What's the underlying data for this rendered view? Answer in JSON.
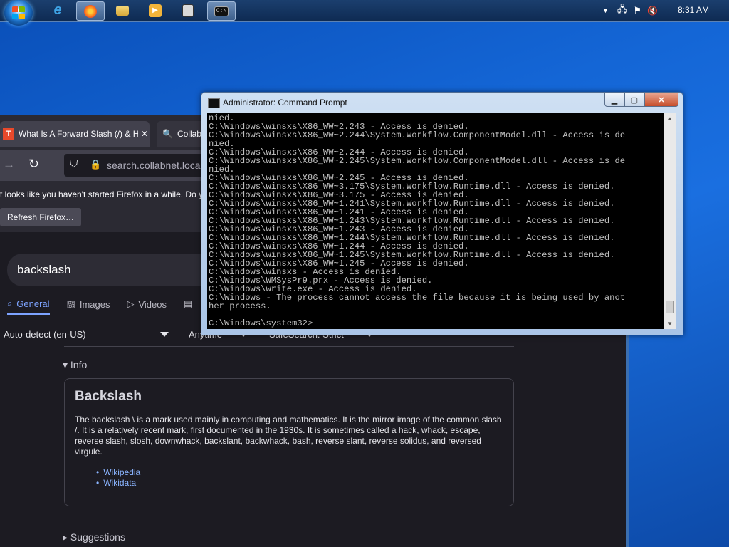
{
  "taskbar": {
    "clock": "8:31 AM",
    "pinned": [
      {
        "name": "internet-explorer-icon",
        "color": "#3ea3e6"
      },
      {
        "name": "firefox-icon",
        "color": "#ff7a1a"
      },
      {
        "name": "file-explorer-icon",
        "color": "#e8c25a"
      },
      {
        "name": "media-player-icon",
        "color": "#f2b43a"
      },
      {
        "name": "calculator-icon",
        "color": "#d9d9d9"
      },
      {
        "name": "cmd-icon",
        "color": "#111111"
      }
    ]
  },
  "browser": {
    "tabs": [
      {
        "label": "What Is A Forward Slash (/) & H",
        "close": "✕"
      },
      {
        "label": "Collab"
      }
    ],
    "url": "search.collabnet.local/",
    "notice_text": "t looks like you haven't started Firefox in a while. Do y",
    "refresh_label": "Refresh Firefox…",
    "search_query": "backslash",
    "search_tabs": [
      "General",
      "Images",
      "Videos"
    ],
    "filters": {
      "language": "Auto-detect (en-US)",
      "time": "Anytime",
      "safesearch": "SafeSearch: Strict"
    },
    "info_heading": "▾ Info",
    "info_title": "Backslash",
    "info_text": "The backslash \\ is a mark used mainly in computing and mathematics. It is the mirror image of the common slash /. It is a relatively recent mark, first documented in the 1930s. It is sometimes called a hack, whack, escape, reverse slash, slosh, downwhack, backslant, backwhack, bash, reverse slant, reverse solidus, and reversed virgule.",
    "info_links": [
      "Wikipedia",
      "Wikidata"
    ],
    "suggestions_heading": "▸ Suggestions"
  },
  "cmd": {
    "title": "Administrator: Command Prompt",
    "lines": [
      "nied.",
      "C:\\Windows\\winsxs\\X86_WW~2.243 - Access is denied.",
      "C:\\Windows\\winsxs\\X86_WW~2.244\\System.Workflow.ComponentModel.dll - Access is de",
      "nied.",
      "C:\\Windows\\winsxs\\X86_WW~2.244 - Access is denied.",
      "C:\\Windows\\winsxs\\X86_WW~2.245\\System.Workflow.ComponentModel.dll - Access is de",
      "nied.",
      "C:\\Windows\\winsxs\\X86_WW~2.245 - Access is denied.",
      "C:\\Windows\\winsxs\\X86_WW~3.175\\System.Workflow.Runtime.dll - Access is denied.",
      "C:\\Windows\\winsxs\\X86_WW~3.175 - Access is denied.",
      "C:\\Windows\\winsxs\\X86_WW~1.241\\System.Workflow.Runtime.dll - Access is denied.",
      "C:\\Windows\\winsxs\\X86_WW~1.241 - Access is denied.",
      "C:\\Windows\\winsxs\\X86_WW~1.243\\System.Workflow.Runtime.dll - Access is denied.",
      "C:\\Windows\\winsxs\\X86_WW~1.243 - Access is denied.",
      "C:\\Windows\\winsxs\\X86_WW~1.244\\System.Workflow.Runtime.dll - Access is denied.",
      "C:\\Windows\\winsxs\\X86_WW~1.244 - Access is denied.",
      "C:\\Windows\\winsxs\\X86_WW~1.245\\System.Workflow.Runtime.dll - Access is denied.",
      "C:\\Windows\\winsxs\\X86_WW~1.245 - Access is denied.",
      "C:\\Windows\\winsxs - Access is denied.",
      "C:\\Windows\\WMSysPr9.prx - Access is denied.",
      "C:\\Windows\\write.exe - Access is denied.",
      "C:\\Windows - The process cannot access the file because it is being used by anot",
      "her process.",
      "",
      "C:\\Windows\\system32>"
    ]
  }
}
